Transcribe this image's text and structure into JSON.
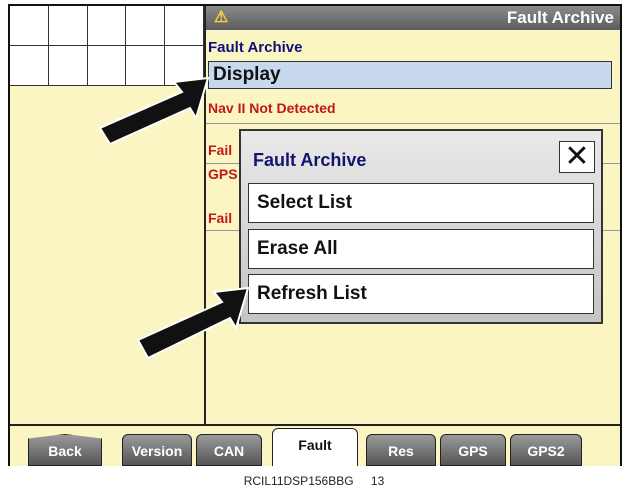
{
  "header": {
    "title": "Fault Archive",
    "icon": "warning-bulb-icon"
  },
  "archive_label": "Fault Archive",
  "display_value": "Display",
  "fault_list": [
    "Nav II Not Detected",
    "Fail",
    "GPS",
    "Fail"
  ],
  "dialog": {
    "title": "Fault Archive",
    "close_symbol": "✕",
    "options": [
      "Select List",
      "Erase All",
      "Refresh List"
    ]
  },
  "tabs": [
    "Back",
    "Version",
    "CAN",
    "Fault",
    "Res",
    "GPS",
    "GPS2"
  ],
  "active_tab": "Fault",
  "caption": {
    "code": "RCIL11DSP156BBG",
    "number": "13"
  },
  "colors": {
    "screen_bg": "#fbf5c3",
    "fault_text": "#c01818",
    "title_text": "#10107a",
    "display_field": "#c8d8ee"
  }
}
